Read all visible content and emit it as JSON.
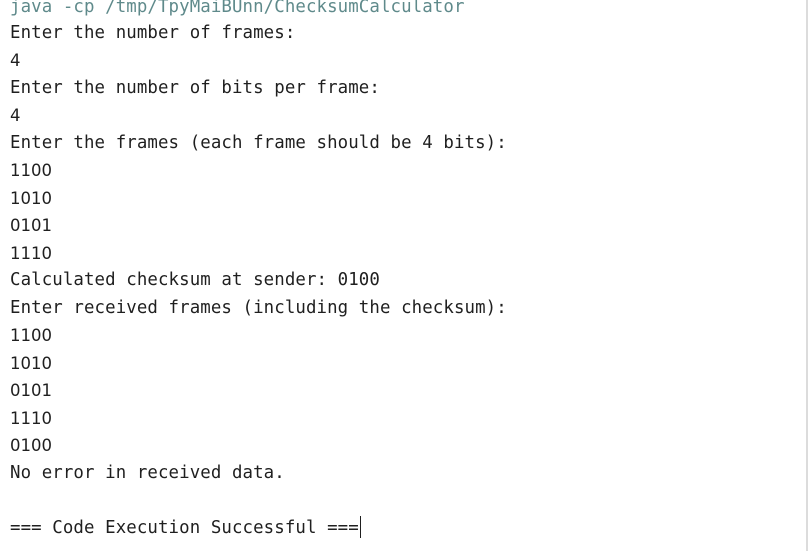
{
  "console": {
    "command": "java -cp /tmp/TpyMaiBUnn/ChecksumCalculator",
    "prompt_frames": "Enter the number of frames:",
    "input_frames": "4",
    "prompt_bits": "Enter the number of bits per frame:",
    "input_bits": "4",
    "prompt_enter_frames": "Enter the frames (each frame should be 4 bits):",
    "sender_frames": [
      "1100",
      "1010",
      "0101",
      "1110"
    ],
    "checksum_line": "Calculated checksum at sender: 0100",
    "prompt_received": "Enter received frames (including the checksum):",
    "received_frames": [
      "1100",
      "1010",
      "0101",
      "1110",
      "0100"
    ],
    "result_line": "No error in received data.",
    "status_line": "=== Code Execution Successful ==="
  },
  "colors": {
    "background": "#ffffff",
    "text": "#1f1f1f",
    "command": "#5f8a8b"
  }
}
